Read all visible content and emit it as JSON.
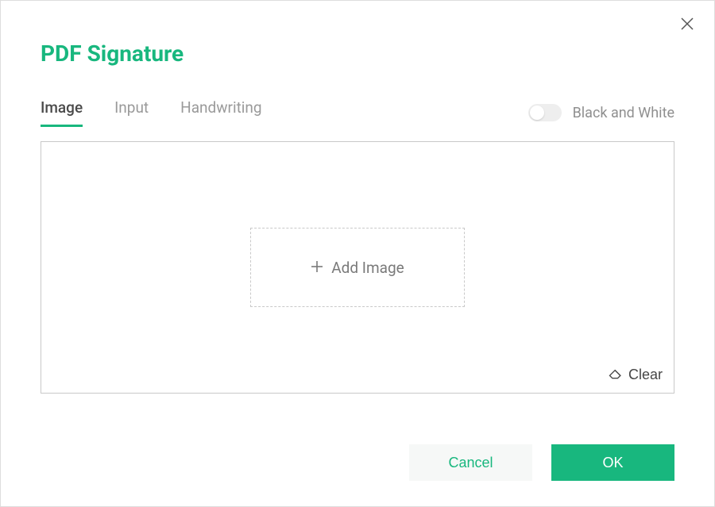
{
  "dialog": {
    "title": "PDF Signature"
  },
  "tabs": {
    "image": "Image",
    "input": "Input",
    "handwriting": "Handwriting"
  },
  "toggle": {
    "bw_label": "Black and White"
  },
  "canvas": {
    "add_image_label": "Add Image",
    "clear_label": "Clear"
  },
  "footer": {
    "cancel_label": "Cancel",
    "ok_label": "OK"
  }
}
